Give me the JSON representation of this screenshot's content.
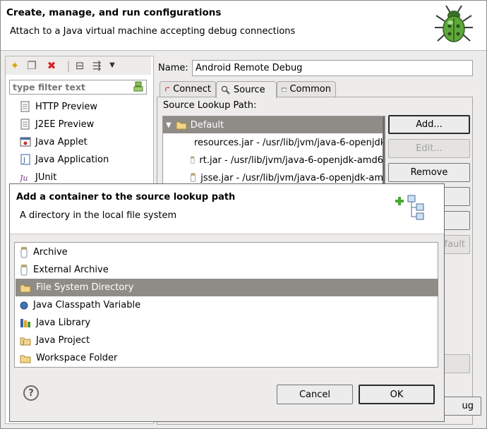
{
  "header": {
    "title": "Create, manage, and run configurations",
    "subtitle": "Attach to a Java virtual machine accepting debug connections"
  },
  "sidebar": {
    "filter_placeholder": "type filter text",
    "items": [
      {
        "label": "HTTP Preview",
        "icon": "web-icon"
      },
      {
        "label": "J2EE Preview",
        "icon": "web-icon"
      },
      {
        "label": "Java Applet",
        "icon": "applet-icon"
      },
      {
        "label": "Java Application",
        "icon": "java-app-icon"
      },
      {
        "label": "JUnit",
        "icon": "junit-icon"
      }
    ]
  },
  "config": {
    "name_label": "Name:",
    "name_value": "Android Remote Debug",
    "tabs": [
      {
        "label": "Connect"
      },
      {
        "label": "Source"
      },
      {
        "label": "Common"
      }
    ],
    "source_label": "Source Lookup Path:",
    "source_items": [
      {
        "label": "Default",
        "selected": true
      },
      {
        "label": "resources.jar - /usr/lib/jvm/java-6-openjdk"
      },
      {
        "label": "rt.jar - /usr/lib/jvm/java-6-openjdk-amd6"
      },
      {
        "label": "jsse.jar - /usr/lib/jvm/java-6-openjdk-am"
      }
    ],
    "buttons": {
      "add": "Add...",
      "edit": "Edit...",
      "remove": "Remove",
      "restore_default_partial": "fault",
      "debug_partial": "ug"
    }
  },
  "dialog": {
    "title": "Add a container to the source lookup path",
    "subtitle": "A directory in the local file system",
    "items": [
      {
        "label": "Archive",
        "icon": "jar-icon"
      },
      {
        "label": "External Archive",
        "icon": "jar-icon"
      },
      {
        "label": "File System Directory",
        "icon": "folder-icon",
        "selected": true
      },
      {
        "label": "Java Classpath Variable",
        "icon": "variable-icon"
      },
      {
        "label": "Java Library",
        "icon": "library-icon"
      },
      {
        "label": "Java Project",
        "icon": "project-icon"
      },
      {
        "label": "Workspace Folder",
        "icon": "folder-icon"
      }
    ],
    "cancel": "Cancel",
    "ok": "OK",
    "help": "?"
  },
  "colors": {
    "selection": "#8f8c87",
    "panel": "#edeceb"
  }
}
